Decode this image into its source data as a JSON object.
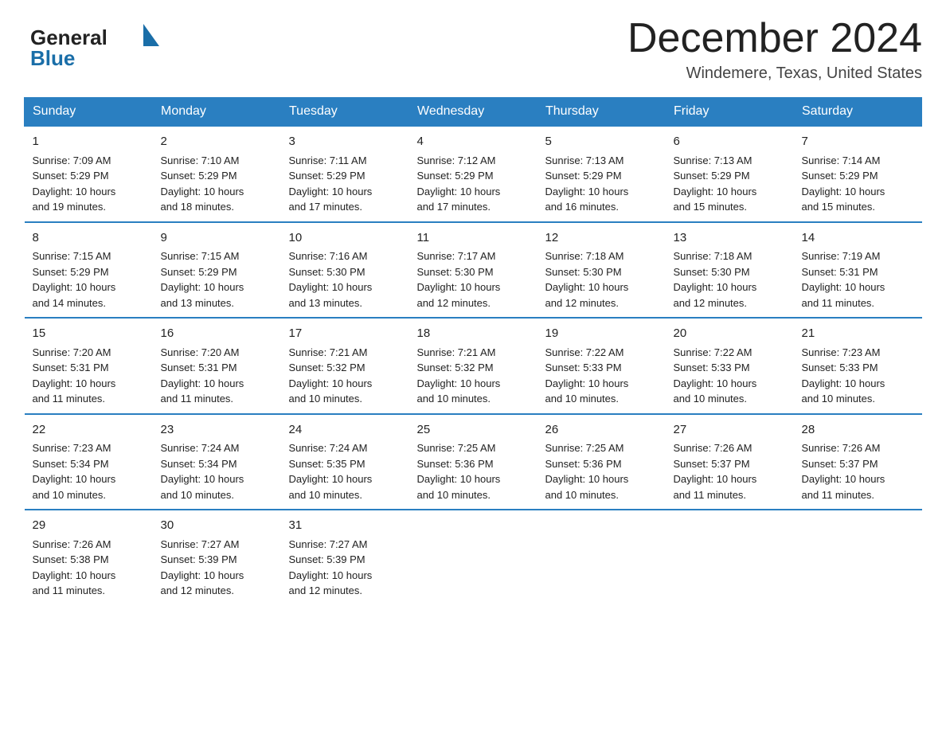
{
  "logo": {
    "general": "General",
    "blue": "Blue"
  },
  "header": {
    "month": "December 2024",
    "location": "Windemere, Texas, United States"
  },
  "days_of_week": [
    "Sunday",
    "Monday",
    "Tuesday",
    "Wednesday",
    "Thursday",
    "Friday",
    "Saturday"
  ],
  "weeks": [
    [
      {
        "day": "1",
        "sunrise": "7:09 AM",
        "sunset": "5:29 PM",
        "daylight": "10 hours and 19 minutes."
      },
      {
        "day": "2",
        "sunrise": "7:10 AM",
        "sunset": "5:29 PM",
        "daylight": "10 hours and 18 minutes."
      },
      {
        "day": "3",
        "sunrise": "7:11 AM",
        "sunset": "5:29 PM",
        "daylight": "10 hours and 17 minutes."
      },
      {
        "day": "4",
        "sunrise": "7:12 AM",
        "sunset": "5:29 PM",
        "daylight": "10 hours and 17 minutes."
      },
      {
        "day": "5",
        "sunrise": "7:13 AM",
        "sunset": "5:29 PM",
        "daylight": "10 hours and 16 minutes."
      },
      {
        "day": "6",
        "sunrise": "7:13 AM",
        "sunset": "5:29 PM",
        "daylight": "10 hours and 15 minutes."
      },
      {
        "day": "7",
        "sunrise": "7:14 AM",
        "sunset": "5:29 PM",
        "daylight": "10 hours and 15 minutes."
      }
    ],
    [
      {
        "day": "8",
        "sunrise": "7:15 AM",
        "sunset": "5:29 PM",
        "daylight": "10 hours and 14 minutes."
      },
      {
        "day": "9",
        "sunrise": "7:15 AM",
        "sunset": "5:29 PM",
        "daylight": "10 hours and 13 minutes."
      },
      {
        "day": "10",
        "sunrise": "7:16 AM",
        "sunset": "5:30 PM",
        "daylight": "10 hours and 13 minutes."
      },
      {
        "day": "11",
        "sunrise": "7:17 AM",
        "sunset": "5:30 PM",
        "daylight": "10 hours and 12 minutes."
      },
      {
        "day": "12",
        "sunrise": "7:18 AM",
        "sunset": "5:30 PM",
        "daylight": "10 hours and 12 minutes."
      },
      {
        "day": "13",
        "sunrise": "7:18 AM",
        "sunset": "5:30 PM",
        "daylight": "10 hours and 12 minutes."
      },
      {
        "day": "14",
        "sunrise": "7:19 AM",
        "sunset": "5:31 PM",
        "daylight": "10 hours and 11 minutes."
      }
    ],
    [
      {
        "day": "15",
        "sunrise": "7:20 AM",
        "sunset": "5:31 PM",
        "daylight": "10 hours and 11 minutes."
      },
      {
        "day": "16",
        "sunrise": "7:20 AM",
        "sunset": "5:31 PM",
        "daylight": "10 hours and 11 minutes."
      },
      {
        "day": "17",
        "sunrise": "7:21 AM",
        "sunset": "5:32 PM",
        "daylight": "10 hours and 10 minutes."
      },
      {
        "day": "18",
        "sunrise": "7:21 AM",
        "sunset": "5:32 PM",
        "daylight": "10 hours and 10 minutes."
      },
      {
        "day": "19",
        "sunrise": "7:22 AM",
        "sunset": "5:33 PM",
        "daylight": "10 hours and 10 minutes."
      },
      {
        "day": "20",
        "sunrise": "7:22 AM",
        "sunset": "5:33 PM",
        "daylight": "10 hours and 10 minutes."
      },
      {
        "day": "21",
        "sunrise": "7:23 AM",
        "sunset": "5:33 PM",
        "daylight": "10 hours and 10 minutes."
      }
    ],
    [
      {
        "day": "22",
        "sunrise": "7:23 AM",
        "sunset": "5:34 PM",
        "daylight": "10 hours and 10 minutes."
      },
      {
        "day": "23",
        "sunrise": "7:24 AM",
        "sunset": "5:34 PM",
        "daylight": "10 hours and 10 minutes."
      },
      {
        "day": "24",
        "sunrise": "7:24 AM",
        "sunset": "5:35 PM",
        "daylight": "10 hours and 10 minutes."
      },
      {
        "day": "25",
        "sunrise": "7:25 AM",
        "sunset": "5:36 PM",
        "daylight": "10 hours and 10 minutes."
      },
      {
        "day": "26",
        "sunrise": "7:25 AM",
        "sunset": "5:36 PM",
        "daylight": "10 hours and 10 minutes."
      },
      {
        "day": "27",
        "sunrise": "7:26 AM",
        "sunset": "5:37 PM",
        "daylight": "10 hours and 11 minutes."
      },
      {
        "day": "28",
        "sunrise": "7:26 AM",
        "sunset": "5:37 PM",
        "daylight": "10 hours and 11 minutes."
      }
    ],
    [
      {
        "day": "29",
        "sunrise": "7:26 AM",
        "sunset": "5:38 PM",
        "daylight": "10 hours and 11 minutes."
      },
      {
        "day": "30",
        "sunrise": "7:27 AM",
        "sunset": "5:39 PM",
        "daylight": "10 hours and 12 minutes."
      },
      {
        "day": "31",
        "sunrise": "7:27 AM",
        "sunset": "5:39 PM",
        "daylight": "10 hours and 12 minutes."
      },
      null,
      null,
      null,
      null
    ]
  ],
  "sunrise_label": "Sunrise:",
  "sunset_label": "Sunset:",
  "daylight_label": "Daylight:"
}
